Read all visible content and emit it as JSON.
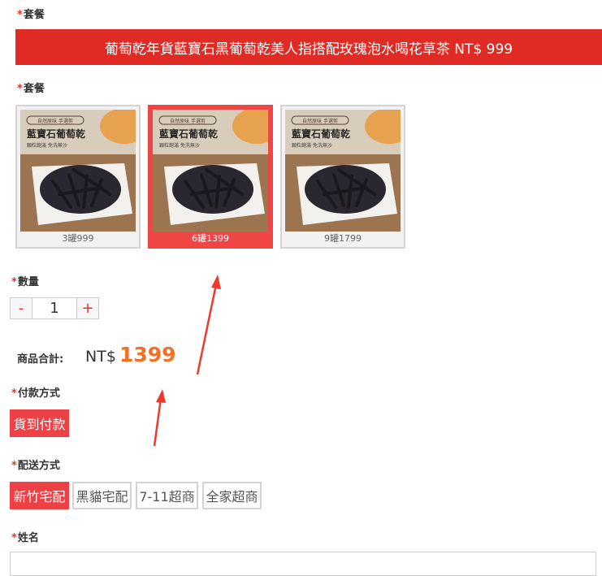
{
  "package_title": {
    "star": "*",
    "label": "套餐"
  },
  "banner_text": "葡萄乾年貨藍寶石黑葡萄乾美人指搭配玫瑰泡水喝花草茶 NT$ 999",
  "package_options_label": {
    "star": "*",
    "label": "套餐"
  },
  "packages": [
    {
      "caption": "3罐999",
      "product_name": "藍寶石葡萄乾",
      "tag_line": "自然原味 手選剪",
      "sub_line": "顆粒飽滿 免洗無沙",
      "selected": false
    },
    {
      "caption": "6罐1399",
      "product_name": "藍寶石葡萄乾",
      "tag_line": "自然原味 手選剪",
      "sub_line": "顆粒飽滿 免洗無沙",
      "selected": true
    },
    {
      "caption": "9罐1799",
      "product_name": "藍寶石葡萄乾",
      "tag_line": "自然原味 手選剪",
      "sub_line": "顆粒飽滿 免洗無沙",
      "selected": false
    }
  ],
  "quantity": {
    "star": "*",
    "label": "數量",
    "minus": "-",
    "value": "1",
    "plus": "+"
  },
  "total": {
    "label": "商品合計:",
    "currency": "NT$",
    "amount": "1399"
  },
  "payment": {
    "star": "*",
    "label": "付款方式",
    "options": [
      "貨到付款"
    ]
  },
  "delivery": {
    "star": "*",
    "label": "配送方式",
    "options": [
      "新竹宅配",
      "黑貓宅配",
      "7-11超商",
      "全家超商"
    ]
  },
  "name_field": {
    "star": "*",
    "label": "姓名",
    "value": ""
  },
  "colors": {
    "accent_red": "#e02a24",
    "selected_red": "#f04545",
    "price_orange": "#f56f24",
    "arrow_red": "#ee3a2e"
  }
}
